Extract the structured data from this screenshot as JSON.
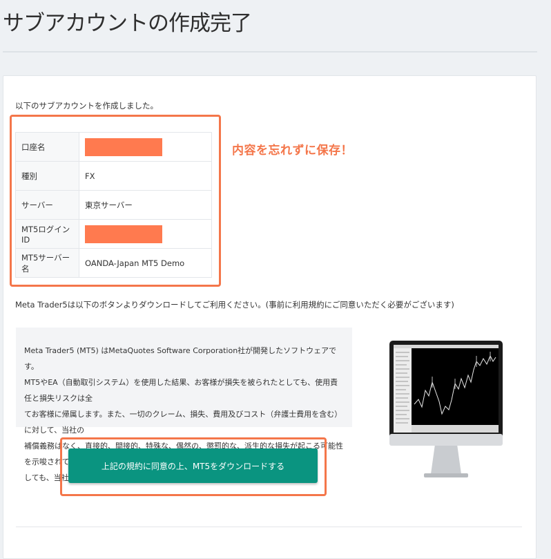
{
  "page": {
    "title": "サブアカウントの作成完了"
  },
  "intro": "以下のサブアカウントを作成しました。",
  "account_table": [
    {
      "label": "口座名",
      "value": "",
      "redacted": true
    },
    {
      "label": "種別",
      "value": "FX",
      "redacted": false
    },
    {
      "label": "サーバー",
      "value": "東京サーバー",
      "redacted": false
    },
    {
      "label": "MT5ログインID",
      "value": "",
      "redacted": true
    },
    {
      "label": "MT5サーバー名",
      "value": "OANDA-Japan MT5 Demo",
      "redacted": false
    }
  ],
  "callout": "内容を忘れずに保存！",
  "mt5_note": "Meta Trader5は以下のボタンよりダウンロードしてご利用ください。(事前に利用規約にご同意いただく必要がございます)",
  "disclaimer": {
    "lines": [
      "Meta Trader5 (MT5) はMetaQuotes Software Corporation社が開発したソフトウェアです。",
      "MT5やEA（自動取引システム）を使用した結果、お客様が損失を被られたとしても、使用責任と損失リスクは全",
      "てお客様に帰属します。また、一切のクレーム、損失、費用及びコスト（弁護士費用を含む）に対して、当社の",
      "補償義務はなく、直接的、間接的、特殊な、偶然の、懲罰的な、派生的な損失が起こる可能性を示唆されていたと",
      "しても、当社は一切責任を負いません。"
    ]
  },
  "download_button": {
    "label": "上記の規約に同意の上、MT5をダウンロードする"
  },
  "colors": {
    "accent": "#0a9480",
    "highlight": "#f4764a",
    "redaction": "#ff7a4f"
  },
  "monitor_icon": "desktop-monitor-chart-illustration"
}
